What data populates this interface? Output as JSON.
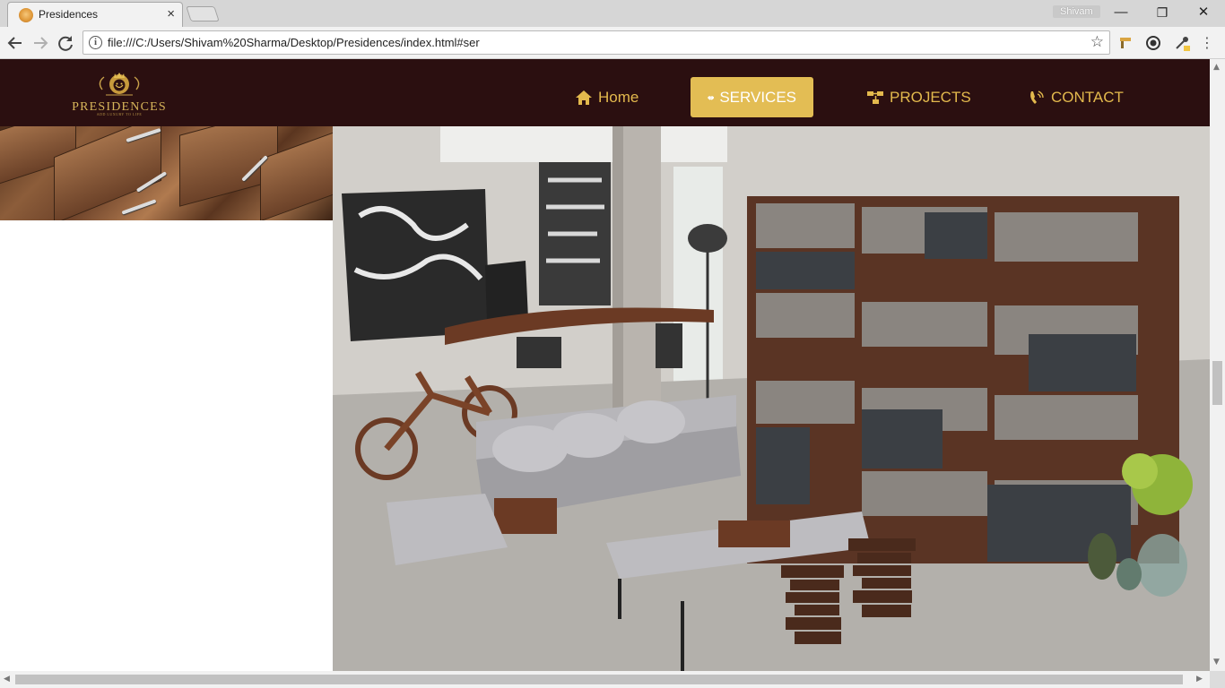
{
  "browser": {
    "tab_title": "Presidences",
    "tab_close": "×",
    "profile_name": "Shivam",
    "url": "file:///C:/Users/Shivam%20Sharma/Desktop/Presidences/index.html#ser",
    "window_controls": {
      "minimize": "—",
      "restore": "❐",
      "close": "✕"
    }
  },
  "site": {
    "logo_text": "PRESIDENCES",
    "logo_tagline": "ADD LUXURY TO LIFE",
    "nav": [
      {
        "label": "Home",
        "icon": "home-icon",
        "active": false
      },
      {
        "label": "SERVICES",
        "icon": "handshake-icon",
        "active": true
      },
      {
        "label": "PROJECTS",
        "icon": "sitemap-icon",
        "active": false
      },
      {
        "label": "CONTACT",
        "icon": "phone-icon",
        "active": false
      }
    ]
  },
  "colors": {
    "header_bg": "#2b0f10",
    "accent_gold": "#e3b94d",
    "active_nav_bg": "#e3bd54",
    "active_nav_text": "#ffffff"
  },
  "images": {
    "left_photo": "wooden-drawers-photo",
    "hero_photo": "loft-living-room-photo"
  }
}
